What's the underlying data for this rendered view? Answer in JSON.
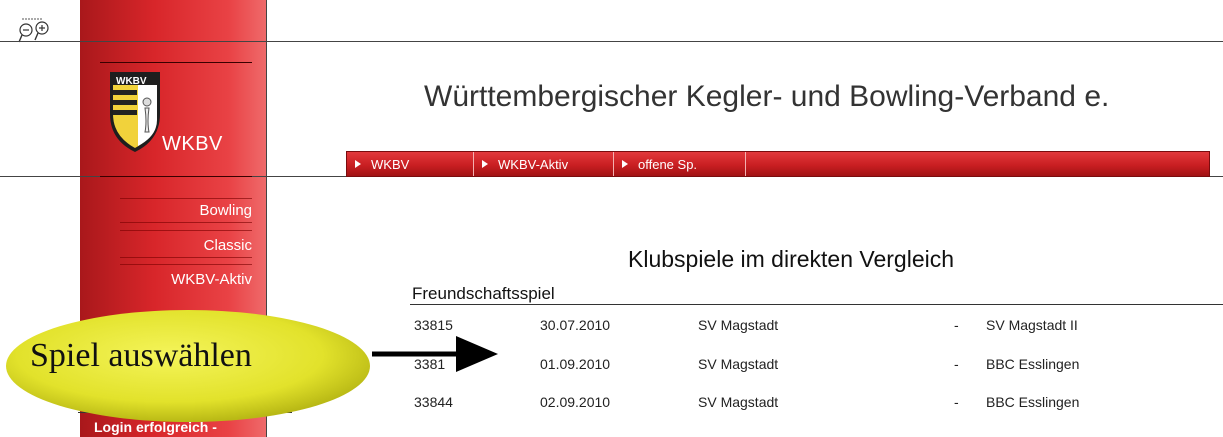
{
  "header": {
    "title": "Württembergischer Kegler- und Bowling-Verband e."
  },
  "logo": {
    "text": "WKBV",
    "crest_text": "WKBV"
  },
  "breadcrumb": [
    {
      "label": "WKBV"
    },
    {
      "label": "WKBV-Aktiv"
    },
    {
      "label": "offene Sp."
    }
  ],
  "sidebar": {
    "items": [
      {
        "label": "Bowling"
      },
      {
        "label": "Classic"
      },
      {
        "label": "WKBV-Aktiv"
      }
    ],
    "login_status": "Login erfolgreich -"
  },
  "main": {
    "title": "Klubspiele im direkten Vergleich",
    "section": "Freundschaftsspiel",
    "rows": [
      {
        "id": "33815",
        "date": "30.07.2010",
        "home": "SV Magstadt",
        "dash": "-",
        "away": "SV Magstadt II"
      },
      {
        "id": "3381",
        "date": "01.09.2010",
        "home": "SV Magstadt",
        "dash": "-",
        "away": "BBC Esslingen"
      },
      {
        "id": "33844",
        "date": "02.09.2010",
        "home": "SV Magstadt",
        "dash": "-",
        "away": "BBC Esslingen"
      }
    ]
  },
  "callout": {
    "text": "Spiel auswählen"
  },
  "colors": {
    "sidebar_red": "#d8262a",
    "breadcrumb_red": "#c91f22",
    "callout_yellow": "#e4e42a"
  }
}
